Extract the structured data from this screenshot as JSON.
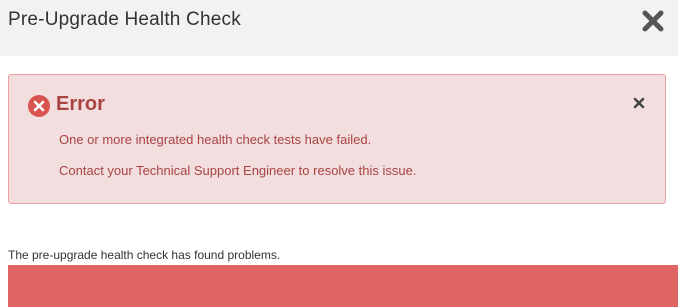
{
  "dialog": {
    "title": "Pre-Upgrade Health Check",
    "close_icon": "close-icon"
  },
  "alert": {
    "icon": "error-circle-icon",
    "title": "Error",
    "dismiss_icon": "close-icon",
    "lines": [
      "One or more integrated health check tests have failed.",
      "Contact your Technical Support Engineer to resolve this issue."
    ]
  },
  "summary": {
    "text": "The pre-upgrade health check has found problems."
  },
  "progress": {
    "percent": 100,
    "status_color": "#e06666"
  },
  "colors": {
    "header_bg": "#f2f2f2",
    "alert_bg": "#f2dede",
    "alert_border": "#e8a0a0",
    "alert_text": "#a94442",
    "error_icon": "#d9534f"
  }
}
